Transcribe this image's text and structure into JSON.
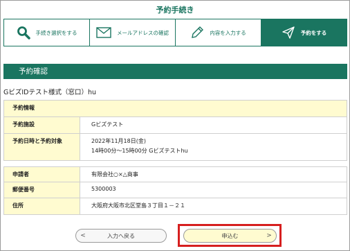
{
  "page_title": "予約手続き",
  "steps": [
    {
      "label": "手続き選択をする",
      "icon": "search-icon",
      "active": false
    },
    {
      "label": "メールアドレスの確認",
      "icon": "mail-icon",
      "active": false
    },
    {
      "label": "内容を入力する",
      "icon": "pencil-icon",
      "active": false
    },
    {
      "label": "予約をする",
      "icon": "send-icon",
      "active": true
    }
  ],
  "section_header": "予約確認",
  "event_title": "GビズIDテスト様式（窓口）hu",
  "reservation": {
    "heading": "予約情報",
    "facility_label": "予約施設",
    "facility_value": "Gビズテスト",
    "datetime_label": "予約日時と予約対象",
    "datetime_value_1": "2022年11月18日(金)",
    "datetime_value_2": "14時00分～15時00分 Gビズテストhu"
  },
  "applicant": {
    "name_label": "申請者",
    "name_value": "有限会社○×△商事",
    "postal_label": "郵便番号",
    "postal_value": "5300003",
    "address_label": "住所",
    "address_value": "大阪府大阪市北区堂島３丁目１－２１"
  },
  "buttons": {
    "back_label": "入力へ戻る",
    "back_arrow": "<",
    "submit_label": "申込む",
    "submit_arrow": ">"
  },
  "colors": {
    "brand": "#1a7560",
    "row_label_bg": "#fffbd0",
    "highlight": "#d61f1f"
  }
}
